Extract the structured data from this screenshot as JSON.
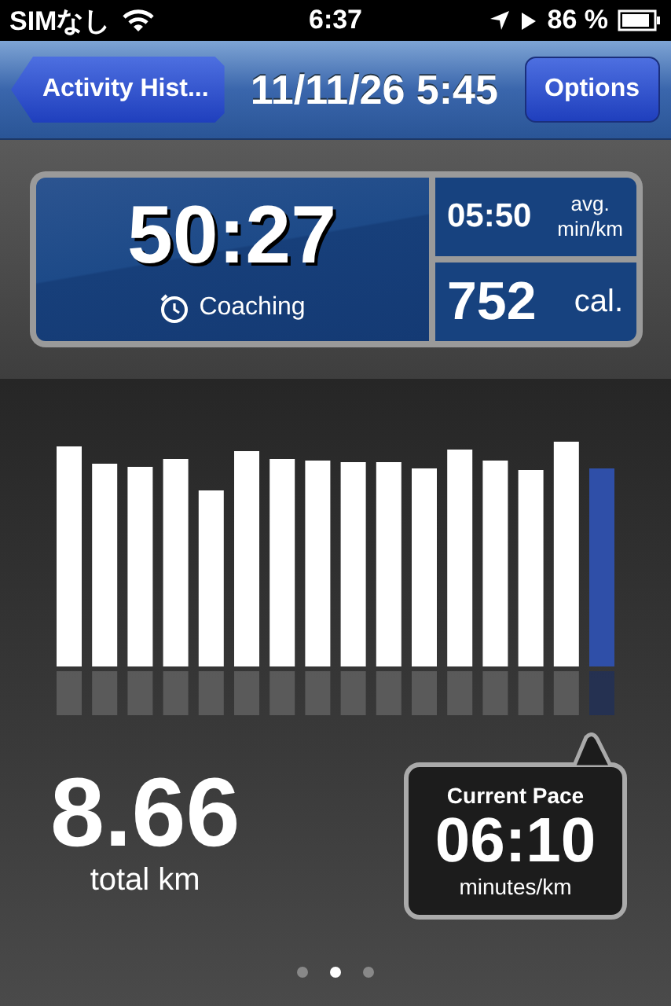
{
  "status_bar": {
    "carrier": "SIMなし",
    "time": "6:37",
    "battery": "86 %"
  },
  "nav_bar": {
    "back_button": "Activity Hist...",
    "title": "11/11/26 5:45",
    "options_button": "Options"
  },
  "summary": {
    "duration": "50:27",
    "coaching": "Coaching",
    "avg_pace": "05:50",
    "avg_label": "avg.",
    "avg_unit": "min/km",
    "calories": "752",
    "calories_unit": "cal."
  },
  "distance": {
    "value": "8.66",
    "unit": "total km"
  },
  "current_pace": {
    "title": "Current Pace",
    "value": "06:10",
    "unit": "minutes/km"
  },
  "page_dots": [
    {
      "selected": false
    },
    {
      "selected": true
    },
    {
      "selected": false
    }
  ]
}
